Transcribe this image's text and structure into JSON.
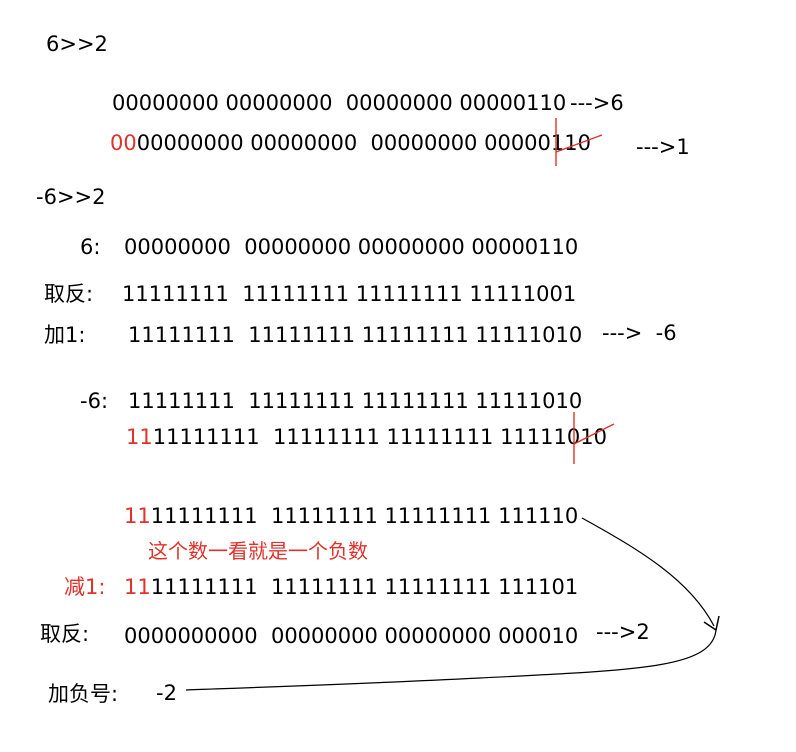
{
  "colors": {
    "text": "#000000",
    "accent": "#e0322b"
  },
  "section1": {
    "title": "6>>2",
    "row1": {
      "bits": "00000000 00000000  00000000 00000110",
      "result": "--->6"
    },
    "row2": {
      "prefix": "00",
      "bits": "00000000 00000000  00000000 000001",
      "cut": "10",
      "result": "--->1"
    }
  },
  "section2": {
    "title": "-6>>2",
    "row_six": {
      "label": "6:",
      "bits": "00000000  00000000 00000000 00000110"
    },
    "row_invert": {
      "label": "取反:",
      "bits": "11111111  11111111 11111111 11111001"
    },
    "row_add1": {
      "label": "加1:",
      "bits": "11111111  11111111 11111111 11111010",
      "result": "--->  -6"
    }
  },
  "section3": {
    "row_neg6": {
      "label": "-6:",
      "bits": "11111111  11111111 11111111 11111010"
    },
    "row_shift": {
      "prefix": "11",
      "bits": "11111111  11111111 11111111 111110",
      "cut": "10"
    }
  },
  "section4": {
    "row_result": {
      "prefix": "11",
      "bits": "11111111  11111111 11111111 111110"
    },
    "note": "这个数一看就是一个负数",
    "row_sub1": {
      "label": "减1:",
      "prefix": "11",
      "bits": "11111111  11111111 11111111 111101"
    },
    "row_invert": {
      "label": "取反:",
      "bits": "0000000000  00000000 00000000 000010",
      "result": "--->2"
    },
    "row_sign": {
      "label": "加负号:",
      "value": "-2"
    }
  }
}
